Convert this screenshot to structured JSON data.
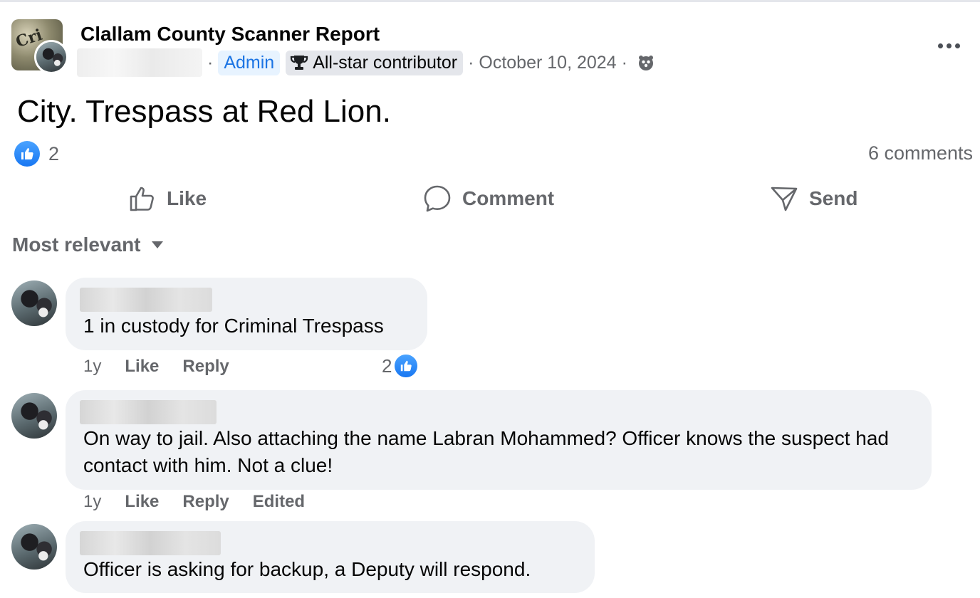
{
  "post": {
    "group_name": "Clallam County Scanner Report",
    "admin_badge": "Admin",
    "contributor_badge": "All-star contributor",
    "date": "October 10, 2024",
    "separator": "·",
    "text": "City. Trespass at Red Lion.",
    "reaction_count": "2",
    "comment_count": "6 comments",
    "privacy": "group-members-icon"
  },
  "actions": {
    "like": "Like",
    "comment": "Comment",
    "send": "Send"
  },
  "sort": {
    "label": "Most relevant"
  },
  "comments": [
    {
      "text": "1 in custody for Criminal Trespass",
      "time": "1y",
      "like": "Like",
      "reply": "Reply",
      "reaction_count": "2"
    },
    {
      "text": "On way to jail. Also attaching the name Labran Mohammed? Officer knows the suspect had contact with him. Not a clue!",
      "time": "1y",
      "like": "Like",
      "reply": "Reply",
      "edited": "Edited"
    },
    {
      "text": "Officer is asking for backup, a Deputy will respond."
    }
  ],
  "colors": {
    "accent": "#1877f2",
    "secondary_text": "#65676b",
    "bubble": "#f0f2f5",
    "admin_badge_bg": "#e7f3ff"
  }
}
